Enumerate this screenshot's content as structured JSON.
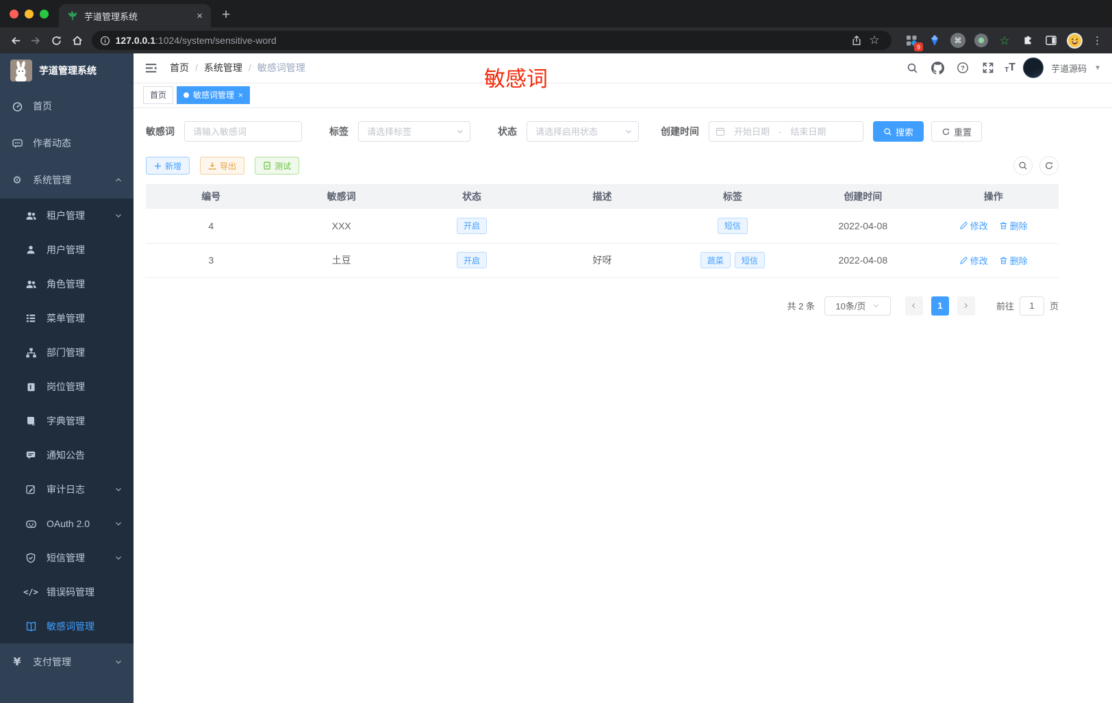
{
  "browser": {
    "tab_title": "芋道管理系统",
    "tab_close": "×",
    "new_tab": "+",
    "url_host": "127.0.0.1",
    "url_path": ":1024/system/sensitive-word",
    "extension_badge": "9",
    "menu_dots": "⋮",
    "star": "☆",
    "cmd_glyph": "⌘"
  },
  "sidebar": {
    "logo_title": "芋道管理系统",
    "items": [
      {
        "label": "首页",
        "icon": "dashboard-icon",
        "level": 1
      },
      {
        "label": "作者动态",
        "icon": "chat-icon",
        "level": 1
      },
      {
        "label": "系统管理",
        "icon": "gear-icon",
        "level": 1,
        "arrow": "up"
      },
      {
        "label": "租户管理",
        "icon": "tenant-icon",
        "level": 2,
        "arrow": "down"
      },
      {
        "label": "用户管理",
        "icon": "user-icon",
        "level": 2
      },
      {
        "label": "角色管理",
        "icon": "role-icon",
        "level": 2
      },
      {
        "label": "菜单管理",
        "icon": "menu-tree-icon",
        "level": 2
      },
      {
        "label": "部门管理",
        "icon": "dept-icon",
        "level": 2
      },
      {
        "label": "岗位管理",
        "icon": "post-icon",
        "level": 2
      },
      {
        "label": "字典管理",
        "icon": "dict-icon",
        "level": 2
      },
      {
        "label": "通知公告",
        "icon": "notice-icon",
        "level": 2
      },
      {
        "label": "审计日志",
        "icon": "audit-icon",
        "level": 2,
        "arrow": "down"
      },
      {
        "label": "OAuth 2.0",
        "icon": "oauth-icon",
        "level": 2,
        "arrow": "down"
      },
      {
        "label": "短信管理",
        "icon": "sms-shield-icon",
        "level": 2,
        "arrow": "down"
      },
      {
        "label": "错误码管理",
        "icon": "errcode-icon",
        "level": 2
      },
      {
        "label": "敏感词管理",
        "icon": "open-book-icon",
        "level": 2,
        "active": true
      },
      {
        "label": "支付管理",
        "icon": "pay-icon",
        "level": 1,
        "arrow": "down"
      }
    ]
  },
  "navbar": {
    "breadcrumb": [
      "首页",
      "系统管理",
      "敏感词管理"
    ],
    "separator": "/",
    "user_name": "芋道源码",
    "annotation": "敏感词"
  },
  "tags_view": {
    "items": [
      {
        "label": "首页",
        "active": false
      },
      {
        "label": "敏感词管理",
        "active": true,
        "close": "×"
      }
    ]
  },
  "filters": {
    "keyword": {
      "label": "敏感词",
      "placeholder": "请输入敏感词"
    },
    "tag": {
      "label": "标签",
      "placeholder": "请选择标签"
    },
    "status": {
      "label": "状态",
      "placeholder": "请选择启用状态"
    },
    "created": {
      "label": "创建时间",
      "start_placeholder": "开始日期",
      "range_separator": "-",
      "end_placeholder": "结束日期"
    },
    "search_label": "搜索",
    "reset_label": "重置"
  },
  "actions": {
    "add": "新增",
    "export": "导出",
    "test": "测试"
  },
  "table": {
    "columns": [
      "编号",
      "敏感词",
      "状态",
      "描述",
      "标签",
      "创建时间",
      "操作"
    ],
    "ops": {
      "edit": "修改",
      "del": "删除"
    },
    "rows": [
      {
        "id": "4",
        "word": "XXX",
        "status": "开启",
        "desc": "",
        "tags": [
          "短信"
        ],
        "created": "2022-04-08"
      },
      {
        "id": "3",
        "word": "土豆",
        "status": "开启",
        "desc": "好呀",
        "tags": [
          "蔬菜",
          "短信"
        ],
        "created": "2022-04-08"
      }
    ]
  },
  "pagination": {
    "total": "共 2 条",
    "page_size": "10条/页",
    "current": "1",
    "goto_label": "前往",
    "goto_value": "1",
    "unit": "页"
  },
  "colors": {
    "primary": "#409eff",
    "annotation_red": "#f42a0a",
    "warning": "#e6a23c",
    "success": "#67c23a",
    "sidebar_bg": "#304156",
    "submenu_bg": "#1f2d3d"
  }
}
